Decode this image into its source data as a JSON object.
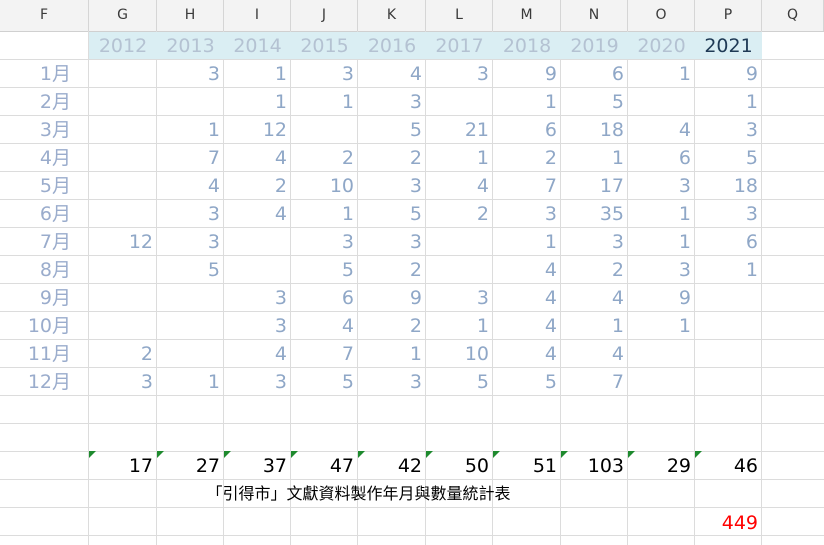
{
  "columns": [
    "F",
    "G",
    "H",
    "I",
    "J",
    "K",
    "L",
    "M",
    "N",
    "O",
    "P",
    "Q"
  ],
  "years": [
    "2012",
    "2013",
    "2014",
    "2015",
    "2016",
    "2017",
    "2018",
    "2019",
    "2020",
    "2021"
  ],
  "current_year": "2021",
  "months": [
    "1月",
    "2月",
    "3月",
    "4月",
    "5月",
    "6月",
    "7月",
    "8月",
    "9月",
    "10月",
    "11月",
    "12月"
  ],
  "values": [
    [
      "",
      "3",
      "1",
      "3",
      "4",
      "3",
      "9",
      "6",
      "1",
      "9"
    ],
    [
      "",
      "",
      "1",
      "1",
      "3",
      "",
      "1",
      "5",
      "",
      "1"
    ],
    [
      "",
      "1",
      "12",
      "",
      "5",
      "21",
      "6",
      "18",
      "4",
      "3"
    ],
    [
      "",
      "7",
      "4",
      "2",
      "2",
      "1",
      "2",
      "1",
      "6",
      "5"
    ],
    [
      "",
      "4",
      "2",
      "10",
      "3",
      "4",
      "7",
      "17",
      "3",
      "18"
    ],
    [
      "",
      "3",
      "4",
      "1",
      "5",
      "2",
      "3",
      "35",
      "1",
      "3"
    ],
    [
      "12",
      "3",
      "",
      "3",
      "3",
      "",
      "1",
      "3",
      "1",
      "6"
    ],
    [
      "",
      "5",
      "",
      "5",
      "2",
      "",
      "4",
      "2",
      "3",
      "1"
    ],
    [
      "",
      "",
      "3",
      "6",
      "9",
      "3",
      "4",
      "4",
      "9",
      ""
    ],
    [
      "",
      "",
      "3",
      "4",
      "2",
      "1",
      "4",
      "1",
      "1",
      ""
    ],
    [
      "2",
      "",
      "4",
      "7",
      "1",
      "10",
      "4",
      "4",
      "",
      ""
    ],
    [
      "3",
      "1",
      "3",
      "5",
      "3",
      "5",
      "5",
      "7",
      "",
      ""
    ]
  ],
  "totals": [
    "17",
    "27",
    "37",
    "47",
    "42",
    "50",
    "51",
    "103",
    "29",
    "46"
  ],
  "caption": "「引得市」文獻資料製作年月與數量統計表",
  "grand_total": "449",
  "colors": {
    "year_band": "#daeef3",
    "grand_total": "#ff0000",
    "error_marker": "#1e8a2e"
  }
}
